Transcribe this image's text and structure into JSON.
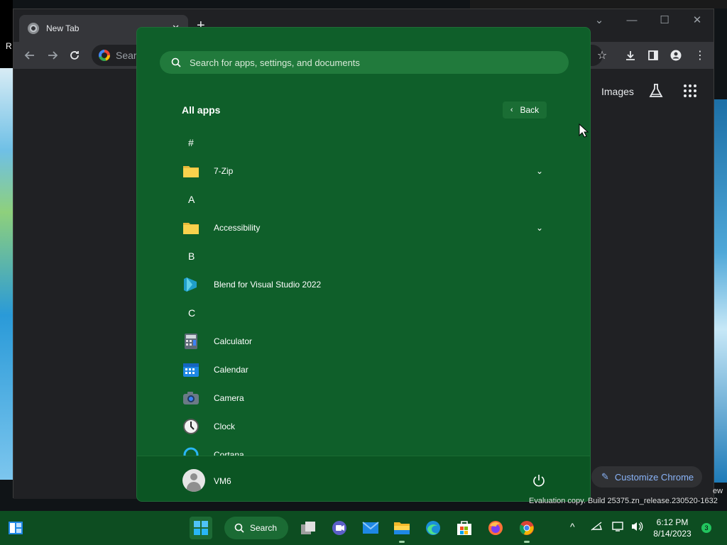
{
  "desktop": {
    "label_fragment": "R"
  },
  "chrome": {
    "tab_title": "New Tab",
    "tab_close": "✕",
    "new_tab": "+",
    "window_controls": [
      "⌄",
      "—",
      "☐",
      "✕"
    ],
    "omnibox_placeholder": "Search",
    "images_link": "Images",
    "customize_label": "Customize Chrome"
  },
  "start_menu": {
    "search_placeholder": "Search for apps, settings, and documents",
    "title": "All apps",
    "back_label": "Back",
    "entries": [
      {
        "kind": "letter",
        "text": "#"
      },
      {
        "kind": "app",
        "text": "7-Zip",
        "icon": "folder-icon",
        "expandable": true
      },
      {
        "kind": "letter",
        "text": "A"
      },
      {
        "kind": "app",
        "text": "Accessibility",
        "icon": "folder-icon",
        "expandable": true
      },
      {
        "kind": "letter",
        "text": "B"
      },
      {
        "kind": "app",
        "text": "Blend for Visual Studio 2022",
        "icon": "blend-icon",
        "expandable": false
      },
      {
        "kind": "letter",
        "text": "C"
      },
      {
        "kind": "app",
        "text": "Calculator",
        "icon": "calculator-icon",
        "expandable": false
      },
      {
        "kind": "app",
        "text": "Calendar",
        "icon": "calendar-icon",
        "expandable": false
      },
      {
        "kind": "app",
        "text": "Camera",
        "icon": "camera-icon",
        "expandable": false
      },
      {
        "kind": "app",
        "text": "Clock",
        "icon": "clock-icon",
        "expandable": false
      },
      {
        "kind": "app",
        "text": "Cortana",
        "icon": "cortana-icon",
        "expandable": false
      }
    ],
    "user_name": "VM6"
  },
  "watermark": {
    "line": "Evaluation copy. Build 25375.zn_release.230520-1632",
    "tail": "ew"
  },
  "taskbar": {
    "search_label": "Search",
    "time": "6:12 PM",
    "date": "8/14/2023",
    "notification_count": "3",
    "tray_chevron": "^"
  },
  "colors": {
    "start_bg": "#0f5f2a",
    "taskbar_bg": "#0d4d21",
    "chrome_bg": "#202124",
    "link_blue": "#8ab4f8"
  }
}
